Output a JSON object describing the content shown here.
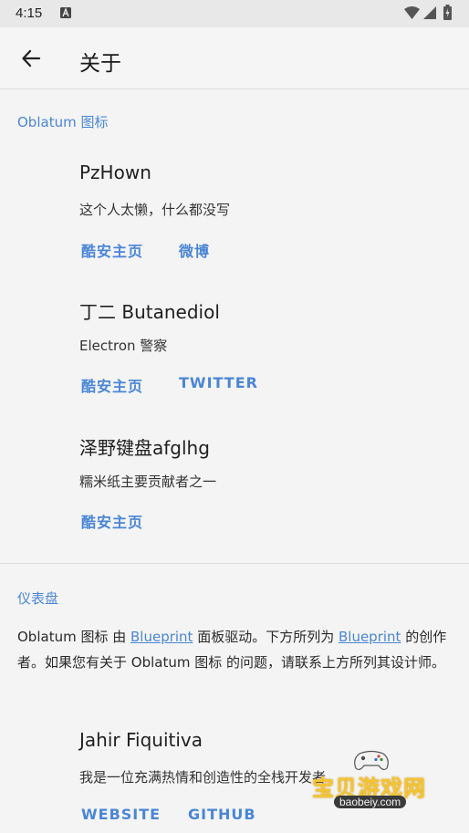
{
  "status_bar": {
    "time": "4:15"
  },
  "app_bar": {
    "title": "关于"
  },
  "section_icons": {
    "header": "Oblatum 图标",
    "people": [
      {
        "name": "PzHown",
        "desc": "这个人太懒，什么都没写",
        "links": [
          "酷安主页",
          "微博"
        ]
      },
      {
        "name": "丁二 Butanediol",
        "desc": "Electron 警察",
        "links": [
          "酷安主页",
          "TWITTER"
        ]
      },
      {
        "name": "泽野键盘afglhg",
        "desc": "糯米纸主要贡献者之一",
        "links": [
          "酷安主页"
        ]
      }
    ]
  },
  "section_dashboard": {
    "header": "仪表盘",
    "text_parts": [
      "Oblatum 图标 由 ",
      "Blueprint",
      " 面板驱动。下方所列为 ",
      "Blueprint",
      " 的创作者。如果您有关于 Oblatum 图标 的问题，请联系上方所列其设计师。"
    ],
    "people": [
      {
        "name": "Jahir Fiquitiva",
        "desc": "我是一位充满热情和创造性的全栈开发者",
        "links": [
          "WEBSITE",
          "GITHUB"
        ]
      }
    ]
  },
  "watermark": {
    "title": "宝贝游戏网",
    "url": "baobeiy.com"
  },
  "colors": {
    "accent": "#4a86d6",
    "background": "#f4f4f4",
    "status_bar": "#e8e8e8",
    "watermark_gold": "#f4c531"
  }
}
